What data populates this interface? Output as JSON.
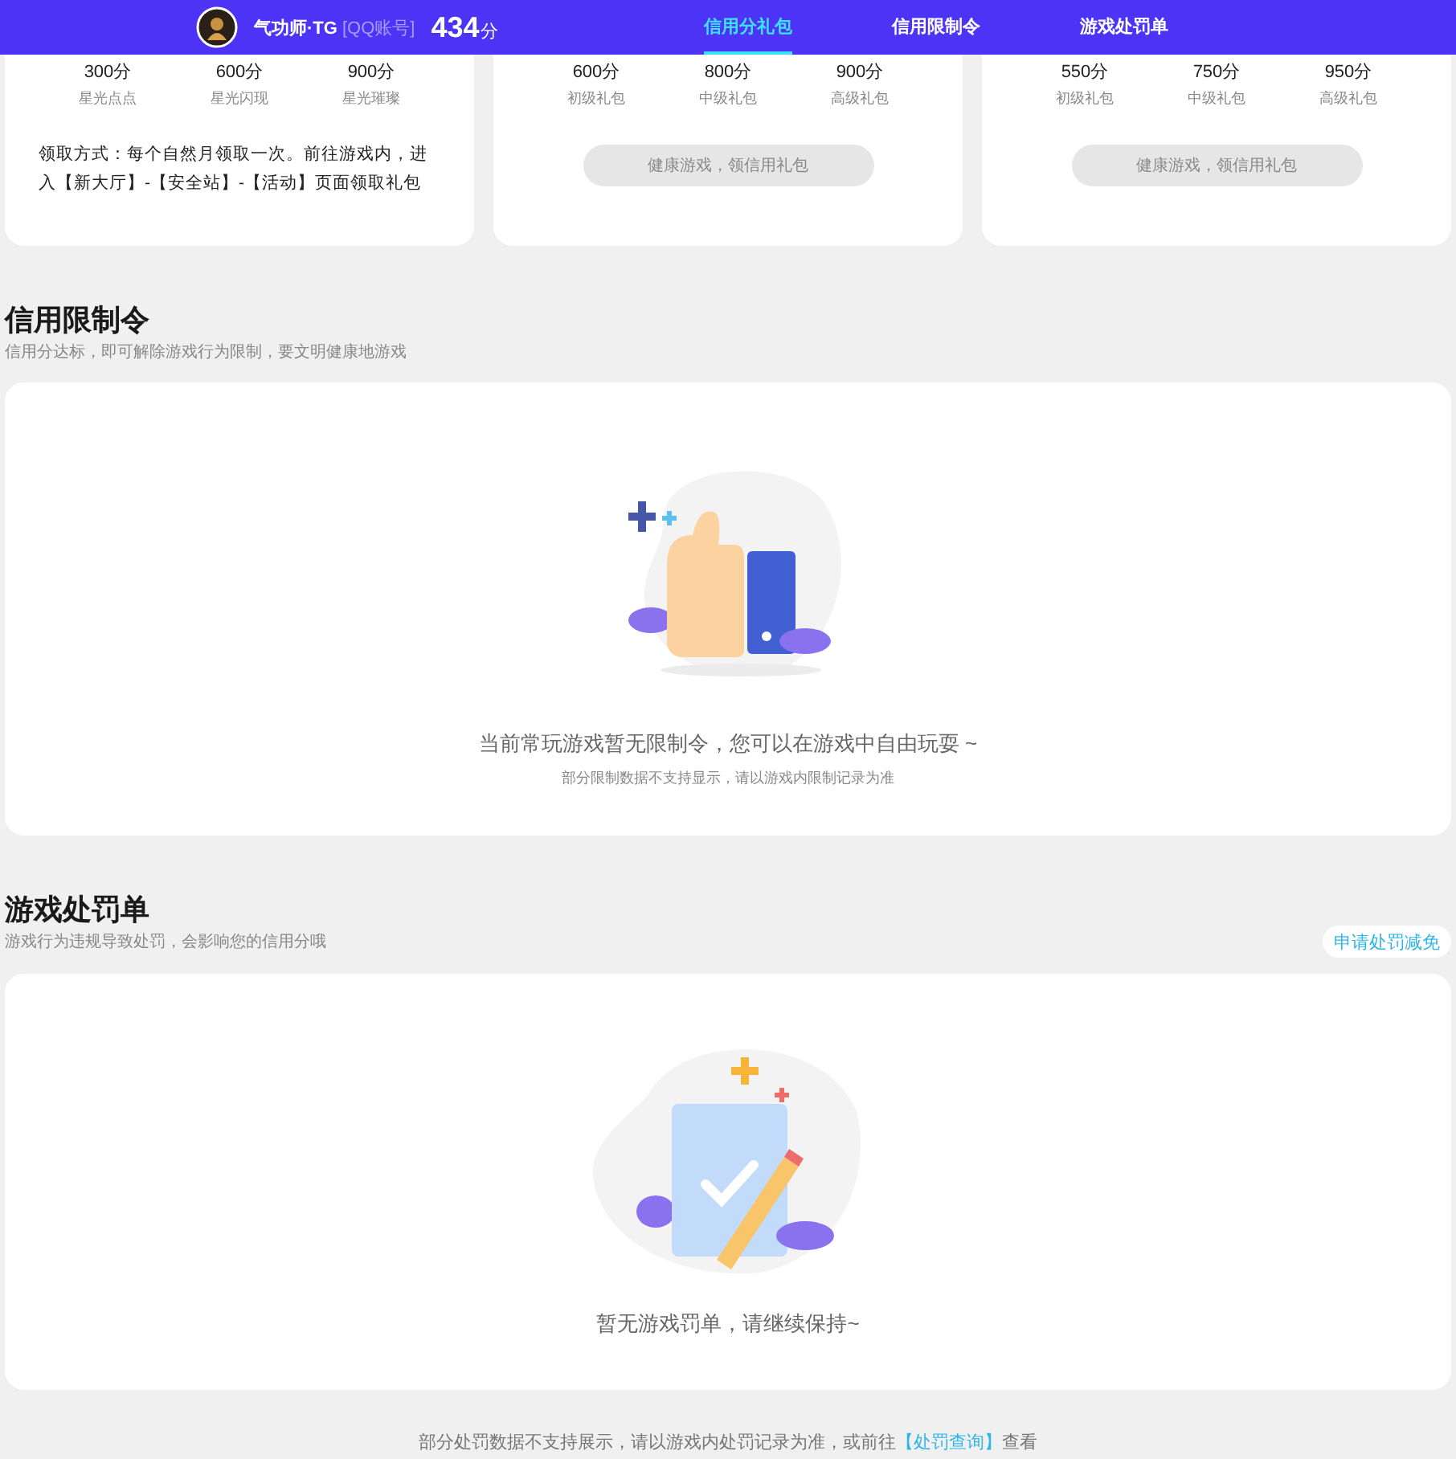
{
  "header": {
    "name": "气功师·TG",
    "account_type": "[QQ账号]",
    "score": "434",
    "score_unit": "分"
  },
  "tabs": [
    {
      "label": "信用分礼包",
      "selected": true
    },
    {
      "label": "信用限制令",
      "selected": false
    },
    {
      "label": "游戏处罚单",
      "selected": false
    }
  ],
  "gift_cards": [
    {
      "tiers": [
        {
          "score": "300分",
          "name": "星光点点"
        },
        {
          "score": "600分",
          "name": "星光闪现"
        },
        {
          "score": "900分",
          "name": "星光璀璨"
        }
      ],
      "kind": "note",
      "note": "领取方式：每个自然月领取一次。前往游戏内，进入【新大厅】-【安全站】-【活动】页面领取礼包"
    },
    {
      "tiers": [
        {
          "score": "600分",
          "name": "初级礼包"
        },
        {
          "score": "800分",
          "name": "中级礼包"
        },
        {
          "score": "900分",
          "name": "高级礼包"
        }
      ],
      "kind": "button",
      "button": {
        "label": "健康游戏，领信用礼包",
        "disabled": true
      }
    },
    {
      "tiers": [
        {
          "score": "550分",
          "name": "初级礼包"
        },
        {
          "score": "750分",
          "name": "中级礼包"
        },
        {
          "score": "950分",
          "name": "高级礼包"
        }
      ],
      "kind": "button",
      "button": {
        "label": "健康游戏，领信用礼包",
        "disabled": true
      }
    }
  ],
  "restriction": {
    "title": "信用限制令",
    "subtitle": "信用分达标，即可解除游戏行为限制，要文明健康地游戏",
    "empty_message": "当前常玩游戏暂无限制令，您可以在游戏中自由玩耍 ~",
    "empty_note": "部分限制数据不支持显示，请以游戏内限制记录为准"
  },
  "penalty": {
    "title": "游戏处罚单",
    "subtitle": "游戏行为违规导致处罚，会影响您的信用分哦",
    "action_button": "申请处罚减免",
    "empty_message": "暂无游戏罚单，请继续保持~"
  },
  "footer": {
    "text": "部分处罚数据不支持展示，请以游戏内处罚记录为准，或前往",
    "link": "【处罚查询】",
    "suffix": "查看"
  }
}
